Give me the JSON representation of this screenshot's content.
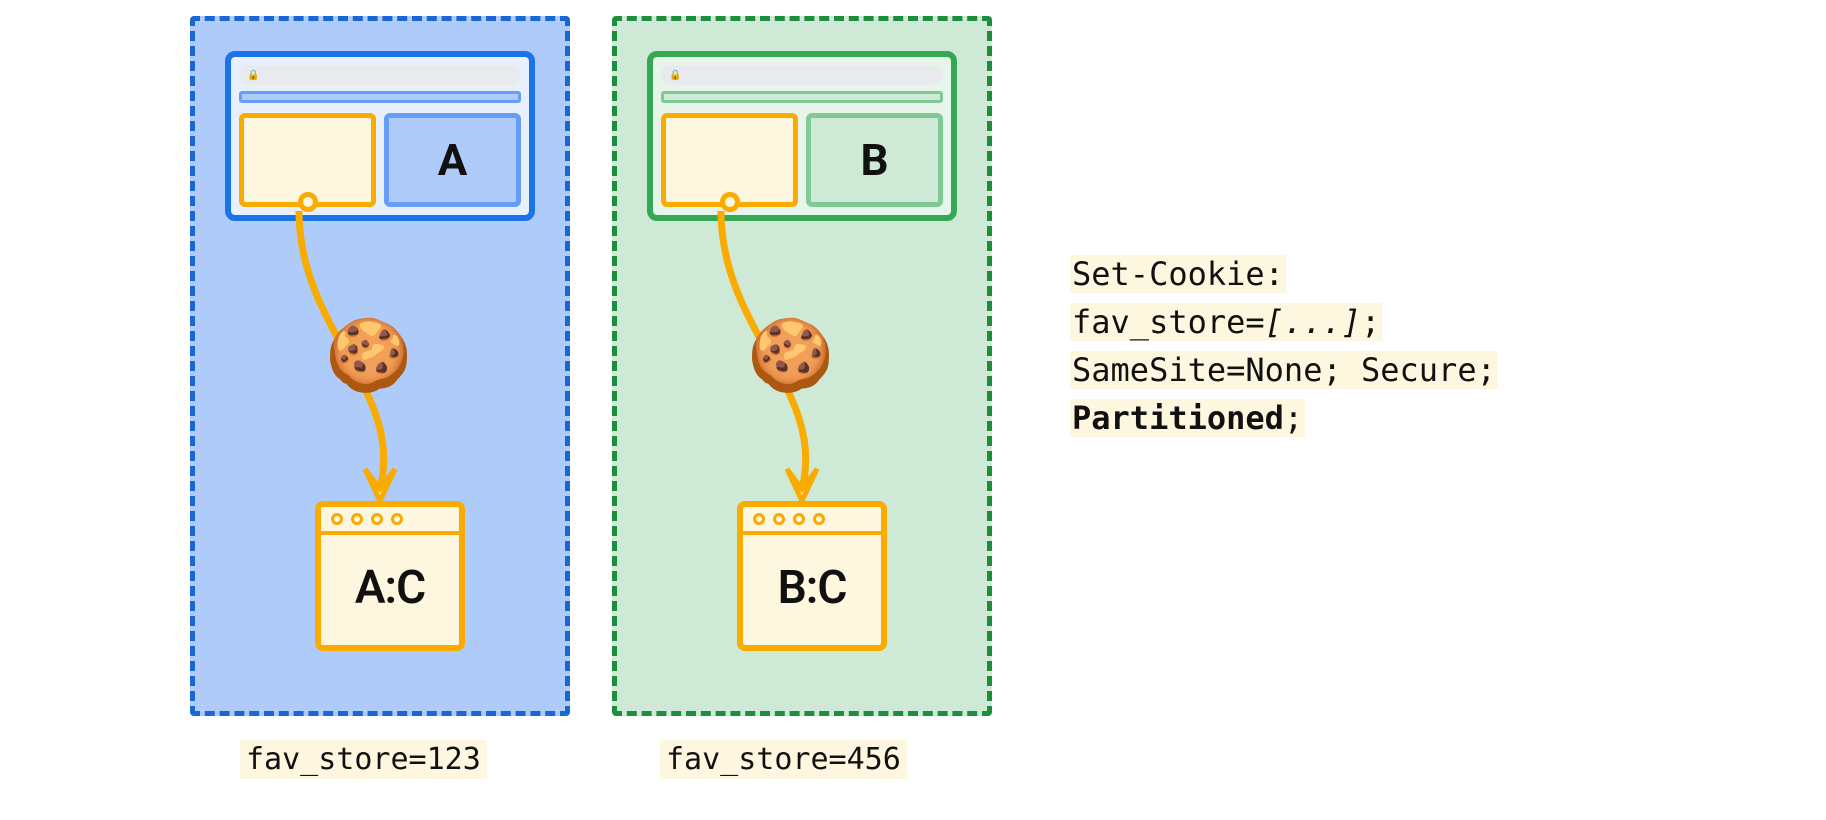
{
  "partition_a": {
    "site_label": "A",
    "jar_label": "A:C",
    "caption": "fav_store=123"
  },
  "partition_b": {
    "site_label": "B",
    "jar_label": "B:C",
    "caption": "fav_store=456"
  },
  "cookie_icon": "🍪",
  "lock_icon": "🔒",
  "code": {
    "line1": "Set-Cookie:",
    "line2_a": "fav_store=",
    "line2_b": "[...]",
    "line2_c": ";",
    "line3": "SameSite=None; Secure;",
    "line4": "Partitioned",
    "line4_b": ";"
  }
}
